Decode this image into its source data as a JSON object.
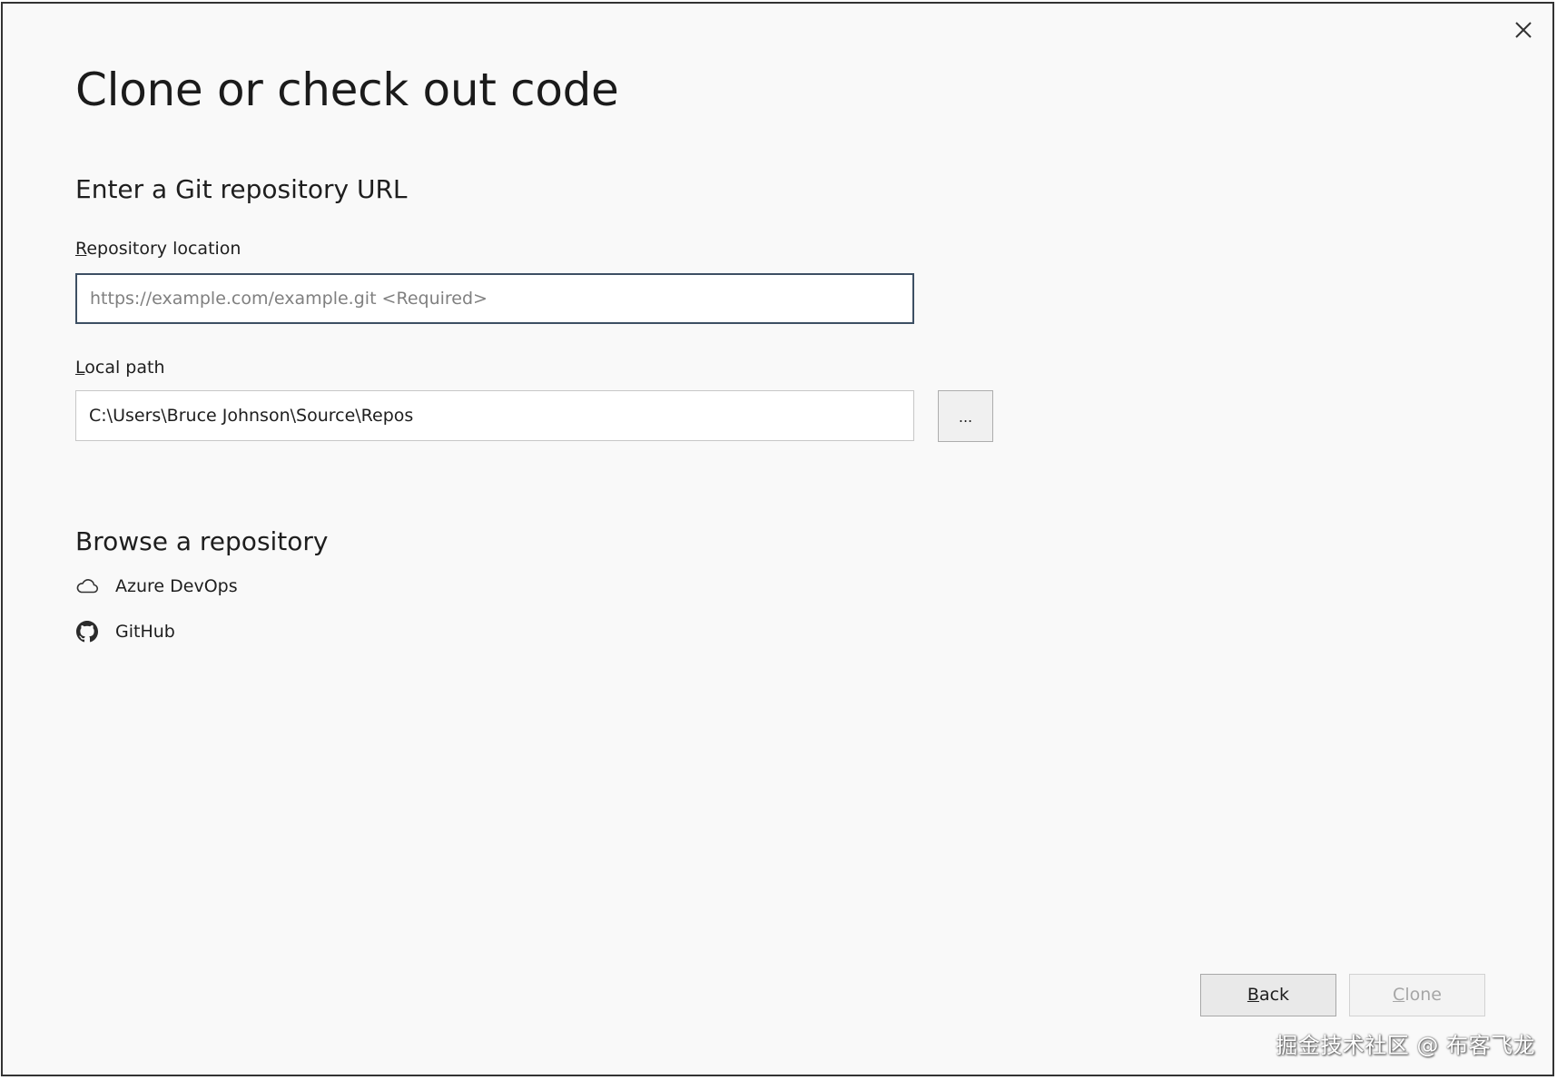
{
  "dialog": {
    "title": "Clone or check out code",
    "close_icon": "close-icon"
  },
  "git_url_section": {
    "heading": "Enter a Git repository URL",
    "repository_location": {
      "label_access_key": "R",
      "label_rest": "epository location",
      "value": "",
      "placeholder": "https://example.com/example.git <Required>"
    },
    "local_path": {
      "label_access_key": "L",
      "label_rest": "ocal path",
      "value": "C:\\Users\\Bruce Johnson\\Source\\Repos",
      "browse_label": "..."
    }
  },
  "browse_section": {
    "heading": "Browse a repository",
    "items": [
      {
        "label": "Azure DevOps",
        "icon": "cloud-icon"
      },
      {
        "label": "GitHub",
        "icon": "github-icon"
      }
    ]
  },
  "footer": {
    "back_access_key": "B",
    "back_rest": "ack",
    "clone_access_key": "C",
    "clone_rest": "lone",
    "clone_enabled": false
  },
  "watermark": "掘金技术社区 @ 布客飞龙",
  "colors": {
    "background": "#f9f9f9",
    "focus_border": "#3d4f63",
    "disabled_text": "#a6a6a6"
  }
}
